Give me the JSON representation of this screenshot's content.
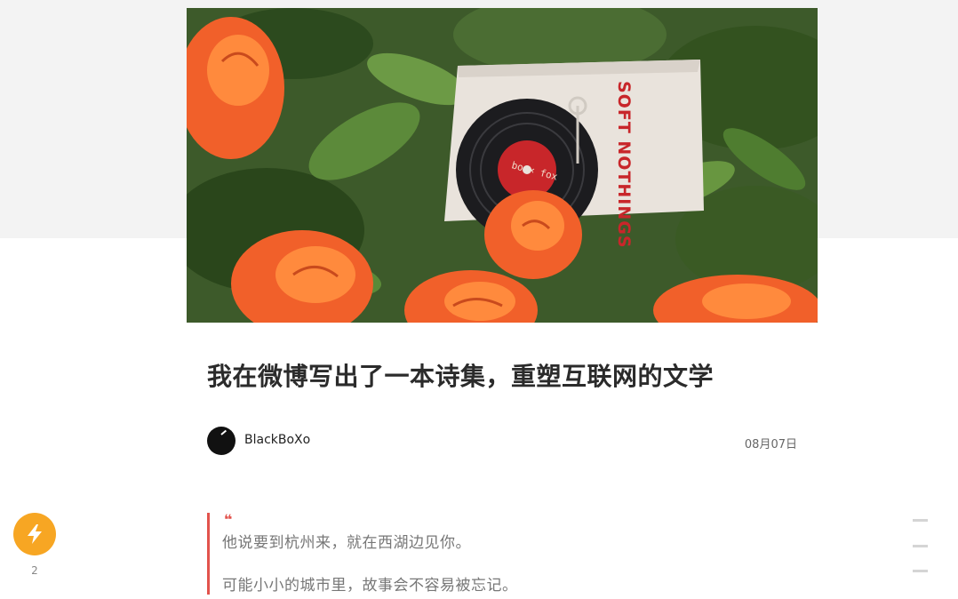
{
  "article": {
    "hero_image": "roses-and-soft-nothings-box-photo",
    "hero_box_text": "SOFT NOTHINGS",
    "hero_record_label": "bo × fox",
    "title": "我在微博写出了一本诗集，重塑互联网的文学",
    "author": "BlackBoXo",
    "date": "08月07日",
    "quote_mark": "❝",
    "quote_lines": [
      "他说要到杭州来，就在西湖边见你。",
      "可能小小的城市里，故事会不容易被忘记。"
    ]
  },
  "sidebar": {
    "like_icon": "lightning-icon",
    "like_count": "2",
    "toc_icon": "toc-lines-icon"
  },
  "colors": {
    "accent_red": "#e2534d",
    "like_orange": "#f7a623",
    "top_band": "#f3f3f3"
  }
}
